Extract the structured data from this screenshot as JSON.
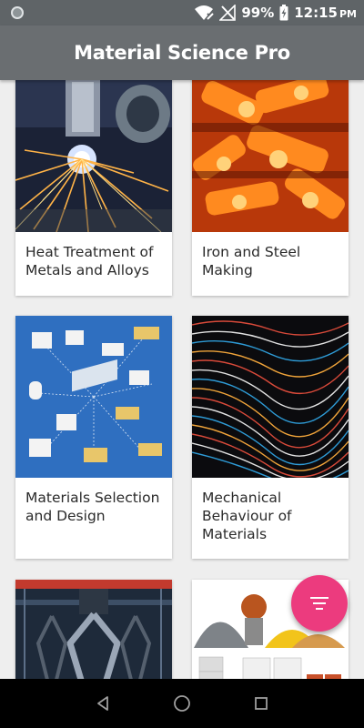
{
  "status_bar": {
    "battery": "99%",
    "time": "12:15",
    "ampm": "PM",
    "icons": [
      "wifi-icon",
      "signal-off-icon",
      "battery-charging-icon"
    ]
  },
  "app_bar": {
    "title": "Material Science Pro"
  },
  "cards": [
    {
      "title": "Heat Treatment of Metals and Alloys",
      "image": "plasma-cutting-image"
    },
    {
      "title": "Iron and Steel Making",
      "image": "molten-metal-image"
    },
    {
      "title": "Materials Selection and Design",
      "image": "materials-infographic-image"
    },
    {
      "title": "Mechanical Behaviour of Materials",
      "image": "wavy-lines-image"
    },
    {
      "title": "",
      "image": "industrial-gripper-image"
    },
    {
      "title": "",
      "image": "construction-materials-image"
    }
  ],
  "fab": {
    "icon": "sort-menu-icon",
    "color": "#ec3b7e"
  },
  "nav_bar": {
    "icons": [
      "back-icon",
      "home-icon",
      "recents-icon"
    ]
  },
  "colors": {
    "app_bar": "#6a6e71",
    "status_bar": "#5f6467",
    "background": "#eeeeee"
  }
}
